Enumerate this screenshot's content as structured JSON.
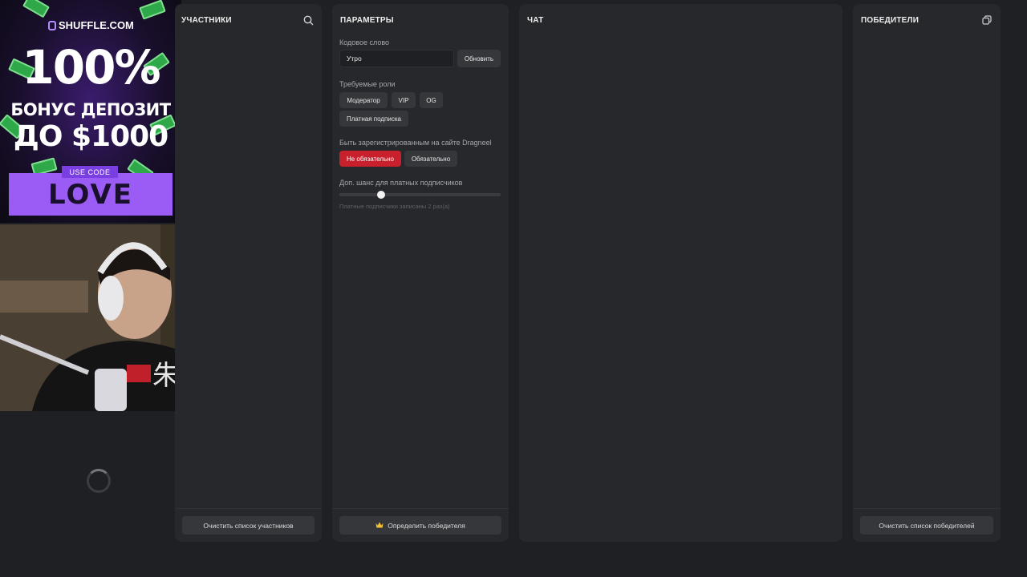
{
  "promo": {
    "brand": "SHUFFLE.COM",
    "headline": "100%",
    "line2": "БОНУС ДЕПОЗИТ",
    "line3": "ДО $1000",
    "use_code_label": "USE CODE",
    "code": "LOVE",
    "brand_color": "#7a3fe0"
  },
  "participants": {
    "title": "УЧАСТНИКИ",
    "search_icon": "search-icon",
    "clear_label": "Очистить список участников"
  },
  "params": {
    "title": "ПАРАМЕТРЫ",
    "keyword_label": "Кодовое слово",
    "keyword_value": "Утро",
    "update_label": "Обновить",
    "roles_label": "Требуемые роли",
    "roles": [
      "Модератор",
      "VIP",
      "OG",
      "Платная подписка"
    ],
    "registered_label": "Быть зарегистрированным на сайте Dragneel",
    "registered_options": [
      "Не обязательно",
      "Обязательно"
    ],
    "registered_selected": "Не обязательно",
    "chance_label": "Доп. шанс для платных подписчиков",
    "chance_fraction": 0.26,
    "chance_hint": "Платные подписчики записаны 2 раз(а)",
    "pick_winner_label": "Определить победителя",
    "crown_icon": "crown-icon",
    "accent_color": "#c8202c"
  },
  "chat": {
    "title": "ЧАТ"
  },
  "winners": {
    "title": "ПОБЕДИТЕЛИ",
    "copy_icon": "copy-icon",
    "clear_label": "Очистить список победителей"
  }
}
